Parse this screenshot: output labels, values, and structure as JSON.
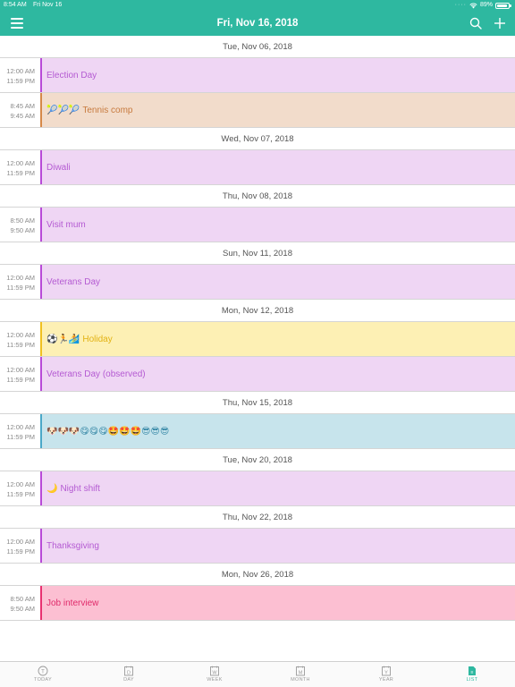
{
  "status_bar": {
    "time": "8:54 AM",
    "date": "Fri Nov 16",
    "battery": "89%",
    "battery_level": 0.89
  },
  "header": {
    "title": "Fri, Nov 16, 2018"
  },
  "colors": {
    "accent": "#2eb8a0",
    "event_lavender": "#efd6f4",
    "event_peach": "#f2dccb",
    "event_yellow": "#fdf0b4",
    "event_blue": "#c7e4ec",
    "event_pink": "#fcbfd2"
  },
  "days": [
    {
      "header": "Tue, Nov 06, 2018",
      "events": [
        {
          "start": "12:00 AM",
          "end": "11:59 PM",
          "emoji": "",
          "title": "Election Day",
          "bg": "#efd6f4",
          "text_color": "#b45ad2",
          "bar": "#b84ad8"
        },
        {
          "start": "8:45 AM",
          "end": "9:45 AM",
          "emoji": "🎾🎾🎾",
          "title": "Tennis comp",
          "bg": "#f2dccb",
          "text_color": "#c77a3e",
          "bar": "#d68848"
        }
      ]
    },
    {
      "header": "Wed, Nov 07, 2018",
      "events": [
        {
          "start": "12:00 AM",
          "end": "11:59 PM",
          "emoji": "",
          "title": "Diwali",
          "bg": "#efd6f4",
          "text_color": "#b45ad2",
          "bar": "#b84ad8"
        }
      ]
    },
    {
      "header": "Thu, Nov 08, 2018",
      "events": [
        {
          "start": "8:50 AM",
          "end": "9:50 AM",
          "emoji": "",
          "title": "Visit mum",
          "bg": "#efd6f4",
          "text_color": "#b45ad2",
          "bar": "#b84ad8"
        }
      ]
    },
    {
      "header": "Sun, Nov 11, 2018",
      "events": [
        {
          "start": "12:00 AM",
          "end": "11:59 PM",
          "emoji": "",
          "title": "Veterans Day",
          "bg": "#efd6f4",
          "text_color": "#b45ad2",
          "bar": "#b84ad8"
        }
      ]
    },
    {
      "header": "Mon, Nov 12, 2018",
      "events": [
        {
          "start": "12:00 AM",
          "end": "11:59 PM",
          "emoji": "⚽🏃🏄",
          "title": "Holiday",
          "bg": "#fdf0b4",
          "text_color": "#e2b213",
          "bar": "#f0c020"
        },
        {
          "start": "12:00 AM",
          "end": "11:59 PM",
          "emoji": "",
          "title": "Veterans Day (observed)",
          "bg": "#efd6f4",
          "text_color": "#b45ad2",
          "bar": "#b84ad8"
        }
      ]
    },
    {
      "header": "Thu, Nov 15, 2018",
      "events": [
        {
          "start": "12:00 AM",
          "end": "11:59 PM",
          "emoji": "🐶🐶🐶😋😋😋🤩🤩🤩😎😎😎",
          "title": "",
          "bg": "#c7e4ec",
          "text_color": "#3a8aa8",
          "bar": "#4aa8c8"
        }
      ]
    },
    {
      "header": "Tue, Nov 20, 2018",
      "events": [
        {
          "start": "12:00 AM",
          "end": "11:59 PM",
          "emoji": "🌙",
          "title": "Night shift",
          "bg": "#efd6f4",
          "text_color": "#b45ad2",
          "bar": "#b84ad8"
        }
      ]
    },
    {
      "header": "Thu, Nov 22, 2018",
      "events": [
        {
          "start": "12:00 AM",
          "end": "11:59 PM",
          "emoji": "",
          "title": "Thanksgiving",
          "bg": "#efd6f4",
          "text_color": "#b45ad2",
          "bar": "#b84ad8"
        }
      ]
    },
    {
      "header": "Mon, Nov 26, 2018",
      "events": [
        {
          "start": "8:50 AM",
          "end": "9:50 AM",
          "emoji": "",
          "title": "Job interview",
          "bg": "#fcbfd2",
          "text_color": "#e02a6a",
          "bar": "#e83070"
        }
      ]
    }
  ],
  "tabs": [
    {
      "label": "TODAY",
      "glyph": "T",
      "icon": "today-icon",
      "active": false
    },
    {
      "label": "DAY",
      "glyph": "D",
      "icon": "day-icon",
      "active": false
    },
    {
      "label": "WEEK",
      "glyph": "W",
      "icon": "week-icon",
      "active": false
    },
    {
      "label": "MONTH",
      "glyph": "M",
      "icon": "month-icon",
      "active": false
    },
    {
      "label": "YEAR",
      "glyph": "Y",
      "icon": "year-icon",
      "active": false
    },
    {
      "label": "LIST",
      "glyph": "≡",
      "icon": "list-icon",
      "active": true
    }
  ]
}
